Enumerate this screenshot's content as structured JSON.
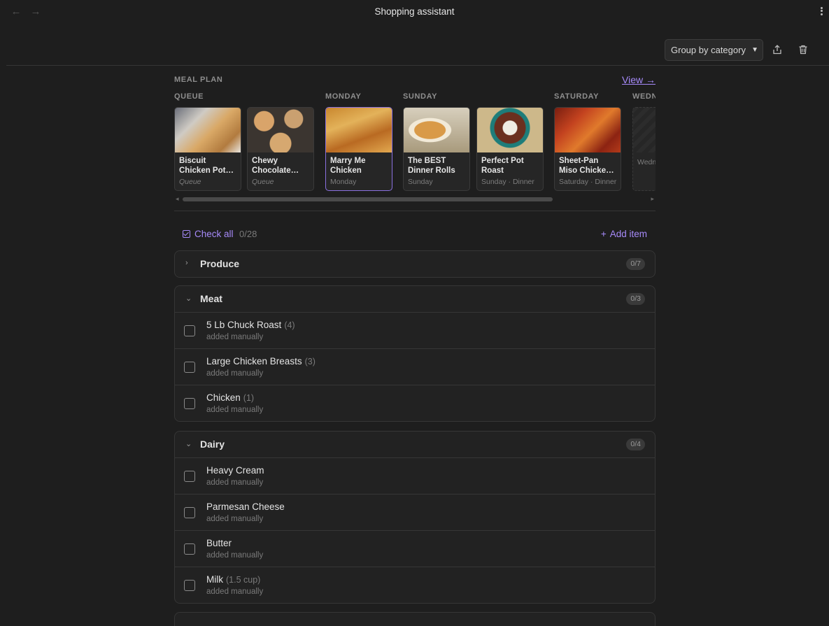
{
  "window": {
    "title": "Shopping assistant"
  },
  "toolbar": {
    "group_by": "Group by category"
  },
  "meal_plan": {
    "heading": "MEAL PLAN",
    "view_link": "View →",
    "columns": [
      {
        "label": "QUEUE"
      },
      {
        "label": "MONDAY"
      },
      {
        "label": "SUNDAY"
      },
      {
        "label": "SATURDAY"
      },
      {
        "label": "WEDN"
      }
    ],
    "cards": [
      {
        "name": "Biscuit Chicken Pot…",
        "sub": "Queue"
      },
      {
        "name": "Chewy Chocolate…",
        "sub": "Queue"
      },
      {
        "name": "Marry Me Chicken",
        "sub": "Monday"
      },
      {
        "name": "The BEST Dinner Rolls",
        "sub": "Sunday"
      },
      {
        "name": "Perfect Pot Roast",
        "sub": "Sunday · Dinner"
      },
      {
        "name": "Sheet-Pan Miso Chicke…",
        "sub": "Saturday · Dinner"
      },
      {
        "name": "",
        "sub": "Wedn"
      }
    ]
  },
  "list": {
    "check_all": "Check all",
    "count": "0/28",
    "add_item": "Add item"
  },
  "groups": [
    {
      "name": "Produce",
      "count": "0/7",
      "expanded": false,
      "items": []
    },
    {
      "name": "Meat",
      "count": "0/3",
      "expanded": true,
      "items": [
        {
          "name": "5 Lb Chuck Roast",
          "qty": "(4)",
          "note": "added manually"
        },
        {
          "name": "Large Chicken Breasts",
          "qty": "(3)",
          "note": "added manually"
        },
        {
          "name": "Chicken",
          "qty": "(1)",
          "note": "added manually"
        }
      ]
    },
    {
      "name": "Dairy",
      "count": "0/4",
      "expanded": true,
      "items": [
        {
          "name": "Heavy Cream",
          "qty": "",
          "note": "added manually"
        },
        {
          "name": "Parmesan Cheese",
          "qty": "",
          "note": "added manually"
        },
        {
          "name": "Butter",
          "qty": "",
          "note": "added manually"
        },
        {
          "name": "Milk",
          "qty": "(1.5 cup)",
          "note": "added manually"
        }
      ]
    }
  ],
  "colors": {
    "accent": "#a68af9",
    "background": "#1e1e1e"
  }
}
